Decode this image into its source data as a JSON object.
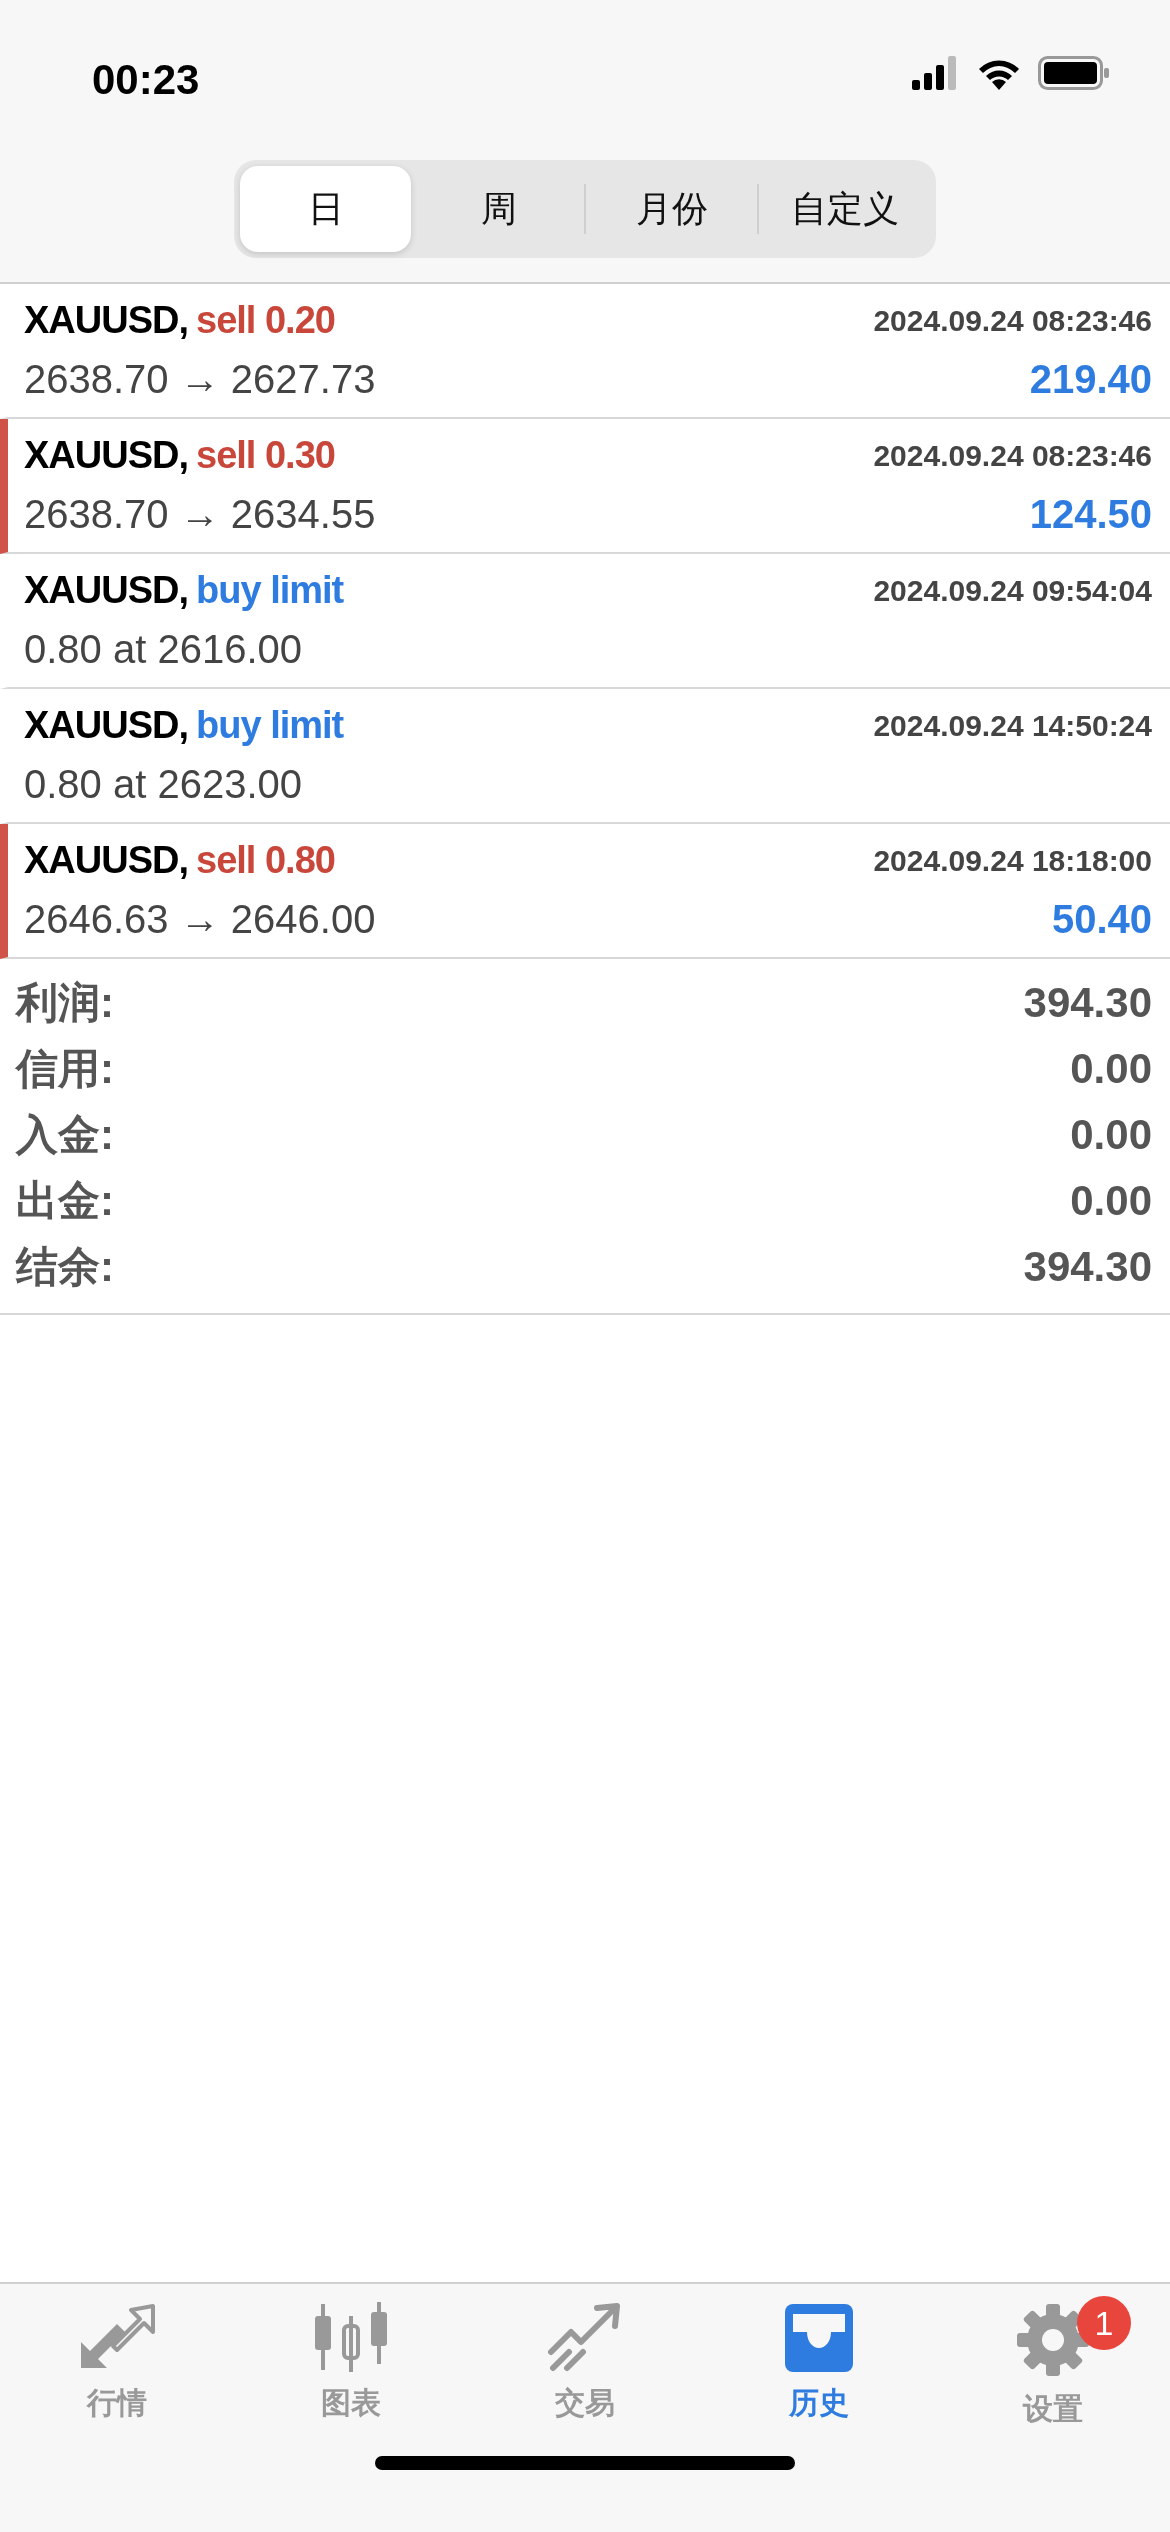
{
  "status_bar": {
    "time": "00:23"
  },
  "period_tabs": [
    {
      "label": "日",
      "selected": true
    },
    {
      "label": "周",
      "selected": false
    },
    {
      "label": "月份",
      "selected": false
    },
    {
      "label": "自定义",
      "selected": false
    }
  ],
  "orders": [
    {
      "symbol": "XAUUSD,",
      "kind": "sell",
      "type": "sell 0.20",
      "time": "2024.09.24 08:23:46",
      "detail": "2638.70 → 2627.73",
      "profit": "219.40",
      "flagged": false
    },
    {
      "symbol": "XAUUSD,",
      "kind": "sell",
      "type": "sell 0.30",
      "time": "2024.09.24 08:23:46",
      "detail": "2638.70 → 2634.55",
      "profit": "124.50",
      "flagged": true
    },
    {
      "symbol": "XAUUSD,",
      "kind": "buy",
      "type": "buy limit",
      "time": "2024.09.24 09:54:04",
      "detail": "0.80 at 2616.00",
      "flagged": false
    },
    {
      "symbol": "XAUUSD,",
      "kind": "buy",
      "type": "buy limit",
      "time": "2024.09.24 14:50:24",
      "detail": "0.80 at 2623.00",
      "flagged": false
    },
    {
      "symbol": "XAUUSD,",
      "kind": "sell",
      "type": "sell 0.80",
      "time": "2024.09.24 18:18:00",
      "detail": "2646.63 → 2646.00",
      "profit": "50.40",
      "flagged": true
    }
  ],
  "summary": [
    {
      "label": "利润:",
      "value": "394.30"
    },
    {
      "label": "信用:",
      "value": "0.00"
    },
    {
      "label": "入金:",
      "value": "0.00"
    },
    {
      "label": "出金:",
      "value": "0.00"
    },
    {
      "label": "结余:",
      "value": "394.30"
    }
  ],
  "tab_bar": [
    {
      "kind": "quotes",
      "label": "行情",
      "selected": false
    },
    {
      "kind": "chart",
      "label": "图表",
      "selected": false
    },
    {
      "kind": "trade",
      "label": "交易",
      "selected": false
    },
    {
      "kind": "history",
      "label": "历史",
      "selected": true
    },
    {
      "kind": "settings",
      "label": "设置",
      "selected": false,
      "badge": "1"
    }
  ]
}
